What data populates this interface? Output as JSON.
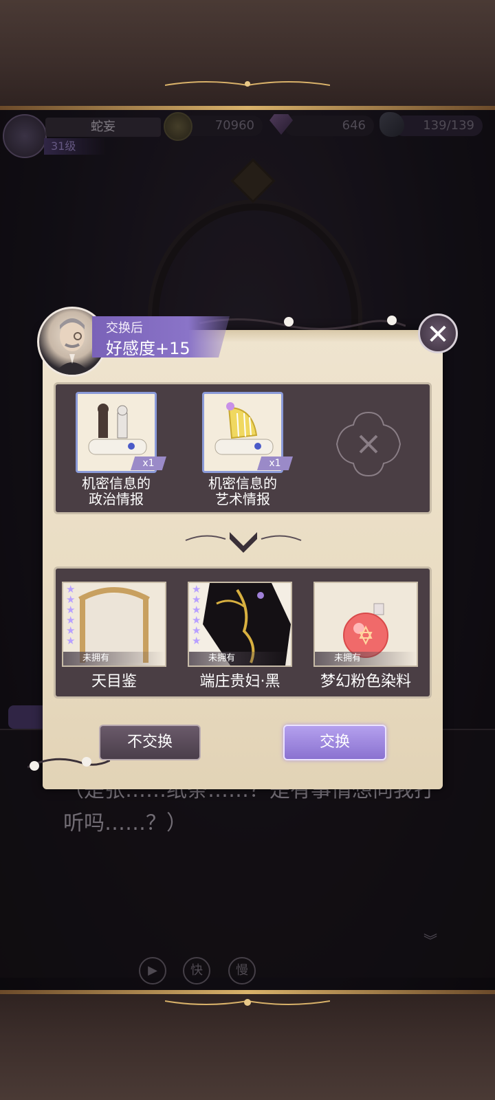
{
  "hud": {
    "player_name": "蛇妄",
    "player_level": "31级",
    "gold": "70960",
    "gems": "646",
    "stamina": "139/139"
  },
  "dialogue": {
    "text": "（是张……纸条……？是有事情想向我打听吗……？）",
    "controls": [
      "快",
      "慢"
    ]
  },
  "exchange_dialog": {
    "affinity_label": "交换后",
    "affinity_value": "好感度+15",
    "close_icon": "close-icon",
    "inputs": [
      {
        "name_line1": "机密信息的",
        "name_line2": "政治情报",
        "qty": "x1",
        "icon": "chess-scroll-icon"
      },
      {
        "name_line1": "机密信息的",
        "name_line2": "艺术情报",
        "qty": "x1",
        "icon": "harp-scroll-icon"
      }
    ],
    "rewards": [
      {
        "name": "天目鉴",
        "tag": "未拥有",
        "stars": 6,
        "icon": "ornate-mirror-icon"
      },
      {
        "name": "端庄贵妇·黑",
        "tag": "未拥有",
        "stars": 6,
        "icon": "black-gold-dress-icon"
      },
      {
        "name": "梦幻粉色染料",
        "tag": "未拥有",
        "stars": 0,
        "icon": "pink-dye-bottle-icon"
      }
    ],
    "buttons": {
      "decline": "不交换",
      "confirm": "交换"
    }
  },
  "colors": {
    "accent_purple": "#8a72d0",
    "panel_bg": "#4a3e44",
    "parchment": "#efe4cf",
    "star": "#b8a0ff"
  }
}
